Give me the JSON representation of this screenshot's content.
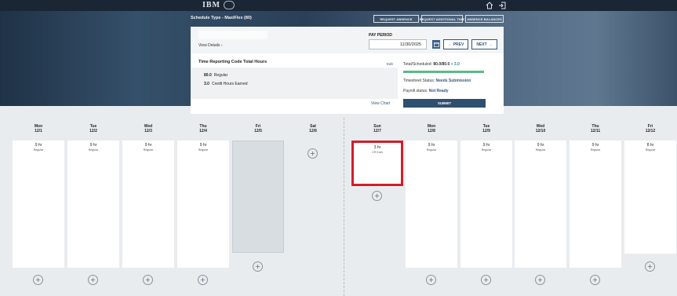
{
  "header": {
    "logo_text": "IBM",
    "home_icon": "home-icon",
    "logout_icon": "logout-icon"
  },
  "schedule": {
    "type_label": "Schedule Type - MaxiFlex (80)"
  },
  "actions": {
    "request_absence": "REQUEST ABSENCE",
    "request_additional_time": "REQUEST ADDITIONAL TIME",
    "absence_balances": "ABSENCE BALANCES"
  },
  "summary": {
    "view_details": "View Details",
    "pay_period_label": "PAY PERIOD",
    "pay_period_value": "11/30/2025",
    "prev_label": "PREV",
    "next_label": "NEXT",
    "trc_title": "Time Reporting Code Total Hours",
    "edit_label": "Edit",
    "view_chart_label": "View Chart",
    "codes": [
      {
        "hours": "80.0",
        "name": "Regular"
      },
      {
        "hours": "3.0",
        "name": "Credit Hours Earned"
      }
    ],
    "total_label": "Total/Scheduled:",
    "total_value": "80.0/80.0",
    "extra_value": "+ 3.0",
    "progress_fraction": 1.0,
    "timesheet_status_label": "Timesheet Status:",
    "timesheet_status_value": "Needs Submission",
    "payroll_status_label": "Payroll status:",
    "payroll_status_value": "Not Ready",
    "submit_label": "SUBMIT"
  },
  "days": [
    {
      "dow": "Mon",
      "date": "12/1",
      "hours": "9 hr",
      "type": "Regular"
    },
    {
      "dow": "Tue",
      "date": "12/2",
      "hours": "9 hr",
      "type": "Regular"
    },
    {
      "dow": "Wed",
      "date": "12/3",
      "hours": "9 hr",
      "type": "Regular"
    },
    {
      "dow": "Thu",
      "date": "12/4",
      "hours": "9 hr",
      "type": "Regular"
    },
    {
      "dow": "Fri",
      "date": "12/5",
      "hours": "",
      "type": ""
    },
    {
      "dow": "Sat",
      "date": "12/6",
      "hours": "",
      "type": ""
    },
    {
      "dow": "Sun",
      "date": "12/7",
      "hours": "3 hr",
      "type": "CR Earn"
    },
    {
      "dow": "Mon",
      "date": "12/8",
      "hours": "9 hr",
      "type": "Regular"
    },
    {
      "dow": "Tue",
      "date": "12/9",
      "hours": "9 hr",
      "type": "Regular"
    },
    {
      "dow": "Wed",
      "date": "12/10",
      "hours": "9 hr",
      "type": "Regular"
    },
    {
      "dow": "Thu",
      "date": "12/11",
      "hours": "9 hr",
      "type": "Regular"
    },
    {
      "dow": "Fri",
      "date": "12/12",
      "hours": "8 hr",
      "type": "Regular"
    }
  ],
  "colors": {
    "accent": "#33567a",
    "highlight": "#d21e2a",
    "progress": "#59bb86"
  }
}
